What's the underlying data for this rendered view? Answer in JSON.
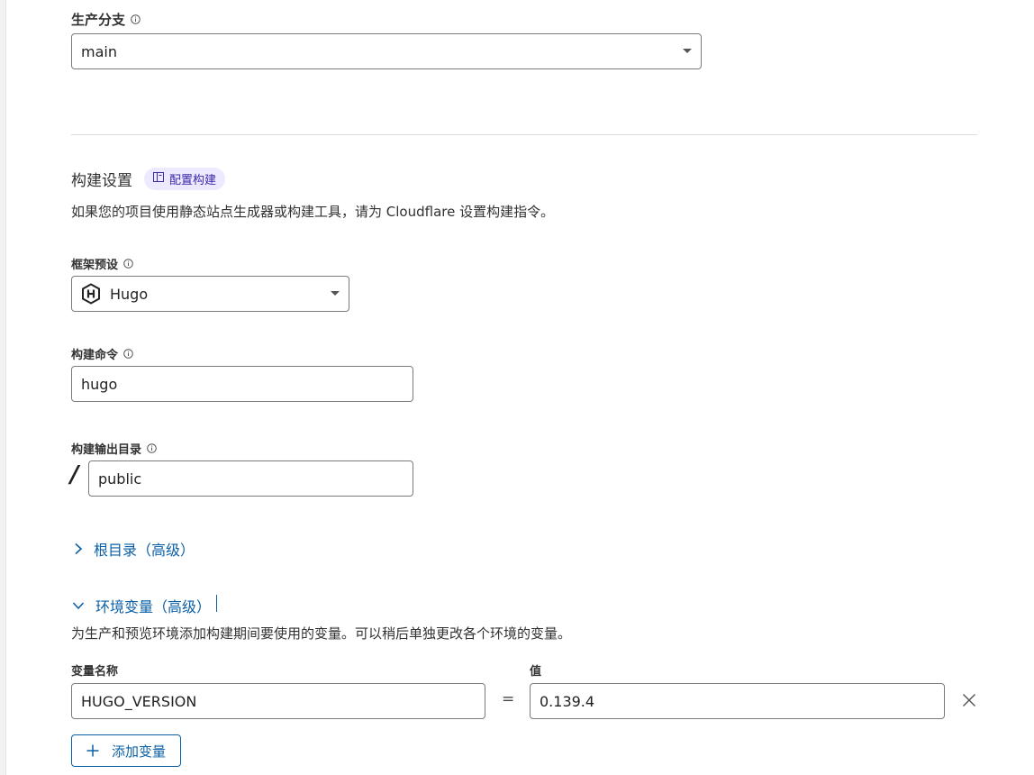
{
  "production_branch": {
    "label": "生产分支",
    "value": "main"
  },
  "build_settings": {
    "title": "构建设置",
    "badge_label": "配置构建",
    "description": "如果您的项目使用静态站点生成器或构建工具，请为 Cloudflare 设置构建指令。",
    "framework_preset": {
      "label": "框架预设",
      "value": "Hugo"
    },
    "build_command": {
      "label": "构建命令",
      "value": "hugo"
    },
    "output_dir": {
      "label": "构建输出目录",
      "prefix": "/",
      "value": "public"
    }
  },
  "root_dir": {
    "label": "根目录（高级）"
  },
  "env_vars": {
    "label": "环境变量（高级）",
    "description": "为生产和预览环境添加构建期间要使用的变量。可以稍后单独更改各个环境的变量。",
    "name_header": "变量名称",
    "value_header": "值",
    "equals": "=",
    "rows": [
      {
        "name": "HUGO_VERSION",
        "value": "0.139.4"
      }
    ],
    "add_label": "添加变量"
  },
  "colors": {
    "link": "#0b5fa5",
    "badge_bg": "#ede9ff",
    "badge_text": "#3b2aa8",
    "border": "#7a7a7a"
  }
}
